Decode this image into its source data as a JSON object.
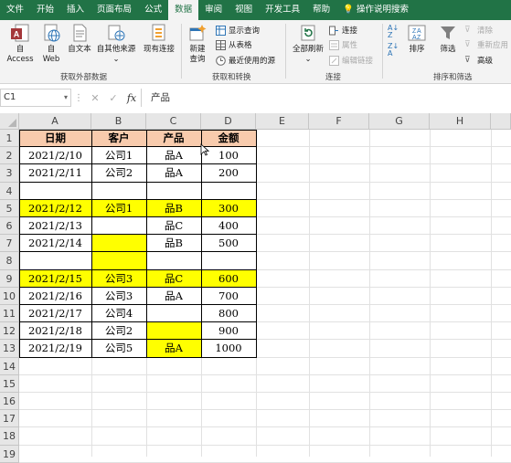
{
  "tabs": [
    "文件",
    "开始",
    "插入",
    "页面布局",
    "公式",
    "数据",
    "审阅",
    "视图",
    "开发工具",
    "帮助",
    "操作说明搜索"
  ],
  "active_tab": 5,
  "ribbon": {
    "groups": {
      "external": "获取外部数据",
      "transform": "获取和转换",
      "connections": "连接",
      "sort_filter": "排序和筛选"
    },
    "buttons": {
      "access": "自 Access",
      "web_1": "自",
      "web_2": "Web",
      "text": "自文本",
      "other": "自其他来源",
      "existing": "现有连接",
      "new_query_1": "新建",
      "new_query_2": "查询",
      "show_queries": "显示查询",
      "from_table": "从表格",
      "recent_sources": "最近使用的源",
      "refresh_all": "全部刷新",
      "connections": "连接",
      "properties": "属性",
      "edit_links": "编辑链接",
      "sort": "排序",
      "filter": "筛选",
      "clear": "清除",
      "reapply": "重新应用",
      "advanced": "高级"
    }
  },
  "formula_bar": {
    "name_box": "C1",
    "content": "产品"
  },
  "columns": [
    "A",
    "B",
    "C",
    "D",
    "E",
    "F",
    "G",
    "H"
  ],
  "rows": [
    "1",
    "2",
    "3",
    "4",
    "5",
    "6",
    "7",
    "8",
    "9",
    "10",
    "11",
    "12",
    "13",
    "14",
    "15",
    "16",
    "17",
    "18",
    "19"
  ],
  "table": {
    "header": [
      "日期",
      "客户",
      "产品",
      "金额"
    ],
    "rows": [
      [
        "2021/2/10",
        "公司1",
        "品A",
        "100"
      ],
      [
        "2021/2/11",
        "公司2",
        "品A",
        "200"
      ],
      [
        "",
        "",
        "",
        ""
      ],
      [
        "2021/2/12",
        "公司1",
        "品B",
        "300"
      ],
      [
        "2021/2/13",
        "",
        "品C",
        "400"
      ],
      [
        "2021/2/14",
        "",
        "品B",
        "500"
      ],
      [
        "",
        "",
        "",
        ""
      ],
      [
        "2021/2/15",
        "公司3",
        "品C",
        "600"
      ],
      [
        "2021/2/16",
        "公司3",
        "品A",
        "700"
      ],
      [
        "2021/2/17",
        "公司4",
        "",
        "800"
      ],
      [
        "2021/2/18",
        "公司2",
        "",
        "900"
      ],
      [
        "2021/2/19",
        "公司5",
        "品A",
        "1000"
      ]
    ],
    "highlight_rows": [
      3,
      7
    ],
    "highlight_cells": [
      [
        5,
        1
      ],
      [
        6,
        1
      ],
      [
        10,
        2
      ],
      [
        11,
        2
      ]
    ]
  },
  "colors": {
    "ribbon_green": "#217346",
    "header_fill": "#f8cbad",
    "highlight": "#ffff00",
    "gridline": "#e1e1e1"
  },
  "icons": [
    "access-icon",
    "web-icon",
    "text-file-icon",
    "other-sources-icon",
    "existing-connections-icon",
    "new-query-icon",
    "refresh-icon",
    "sort-az-icon",
    "sort-za-icon",
    "sort-icon",
    "filter-icon",
    "lightbulb-icon",
    "cursor-icon"
  ]
}
